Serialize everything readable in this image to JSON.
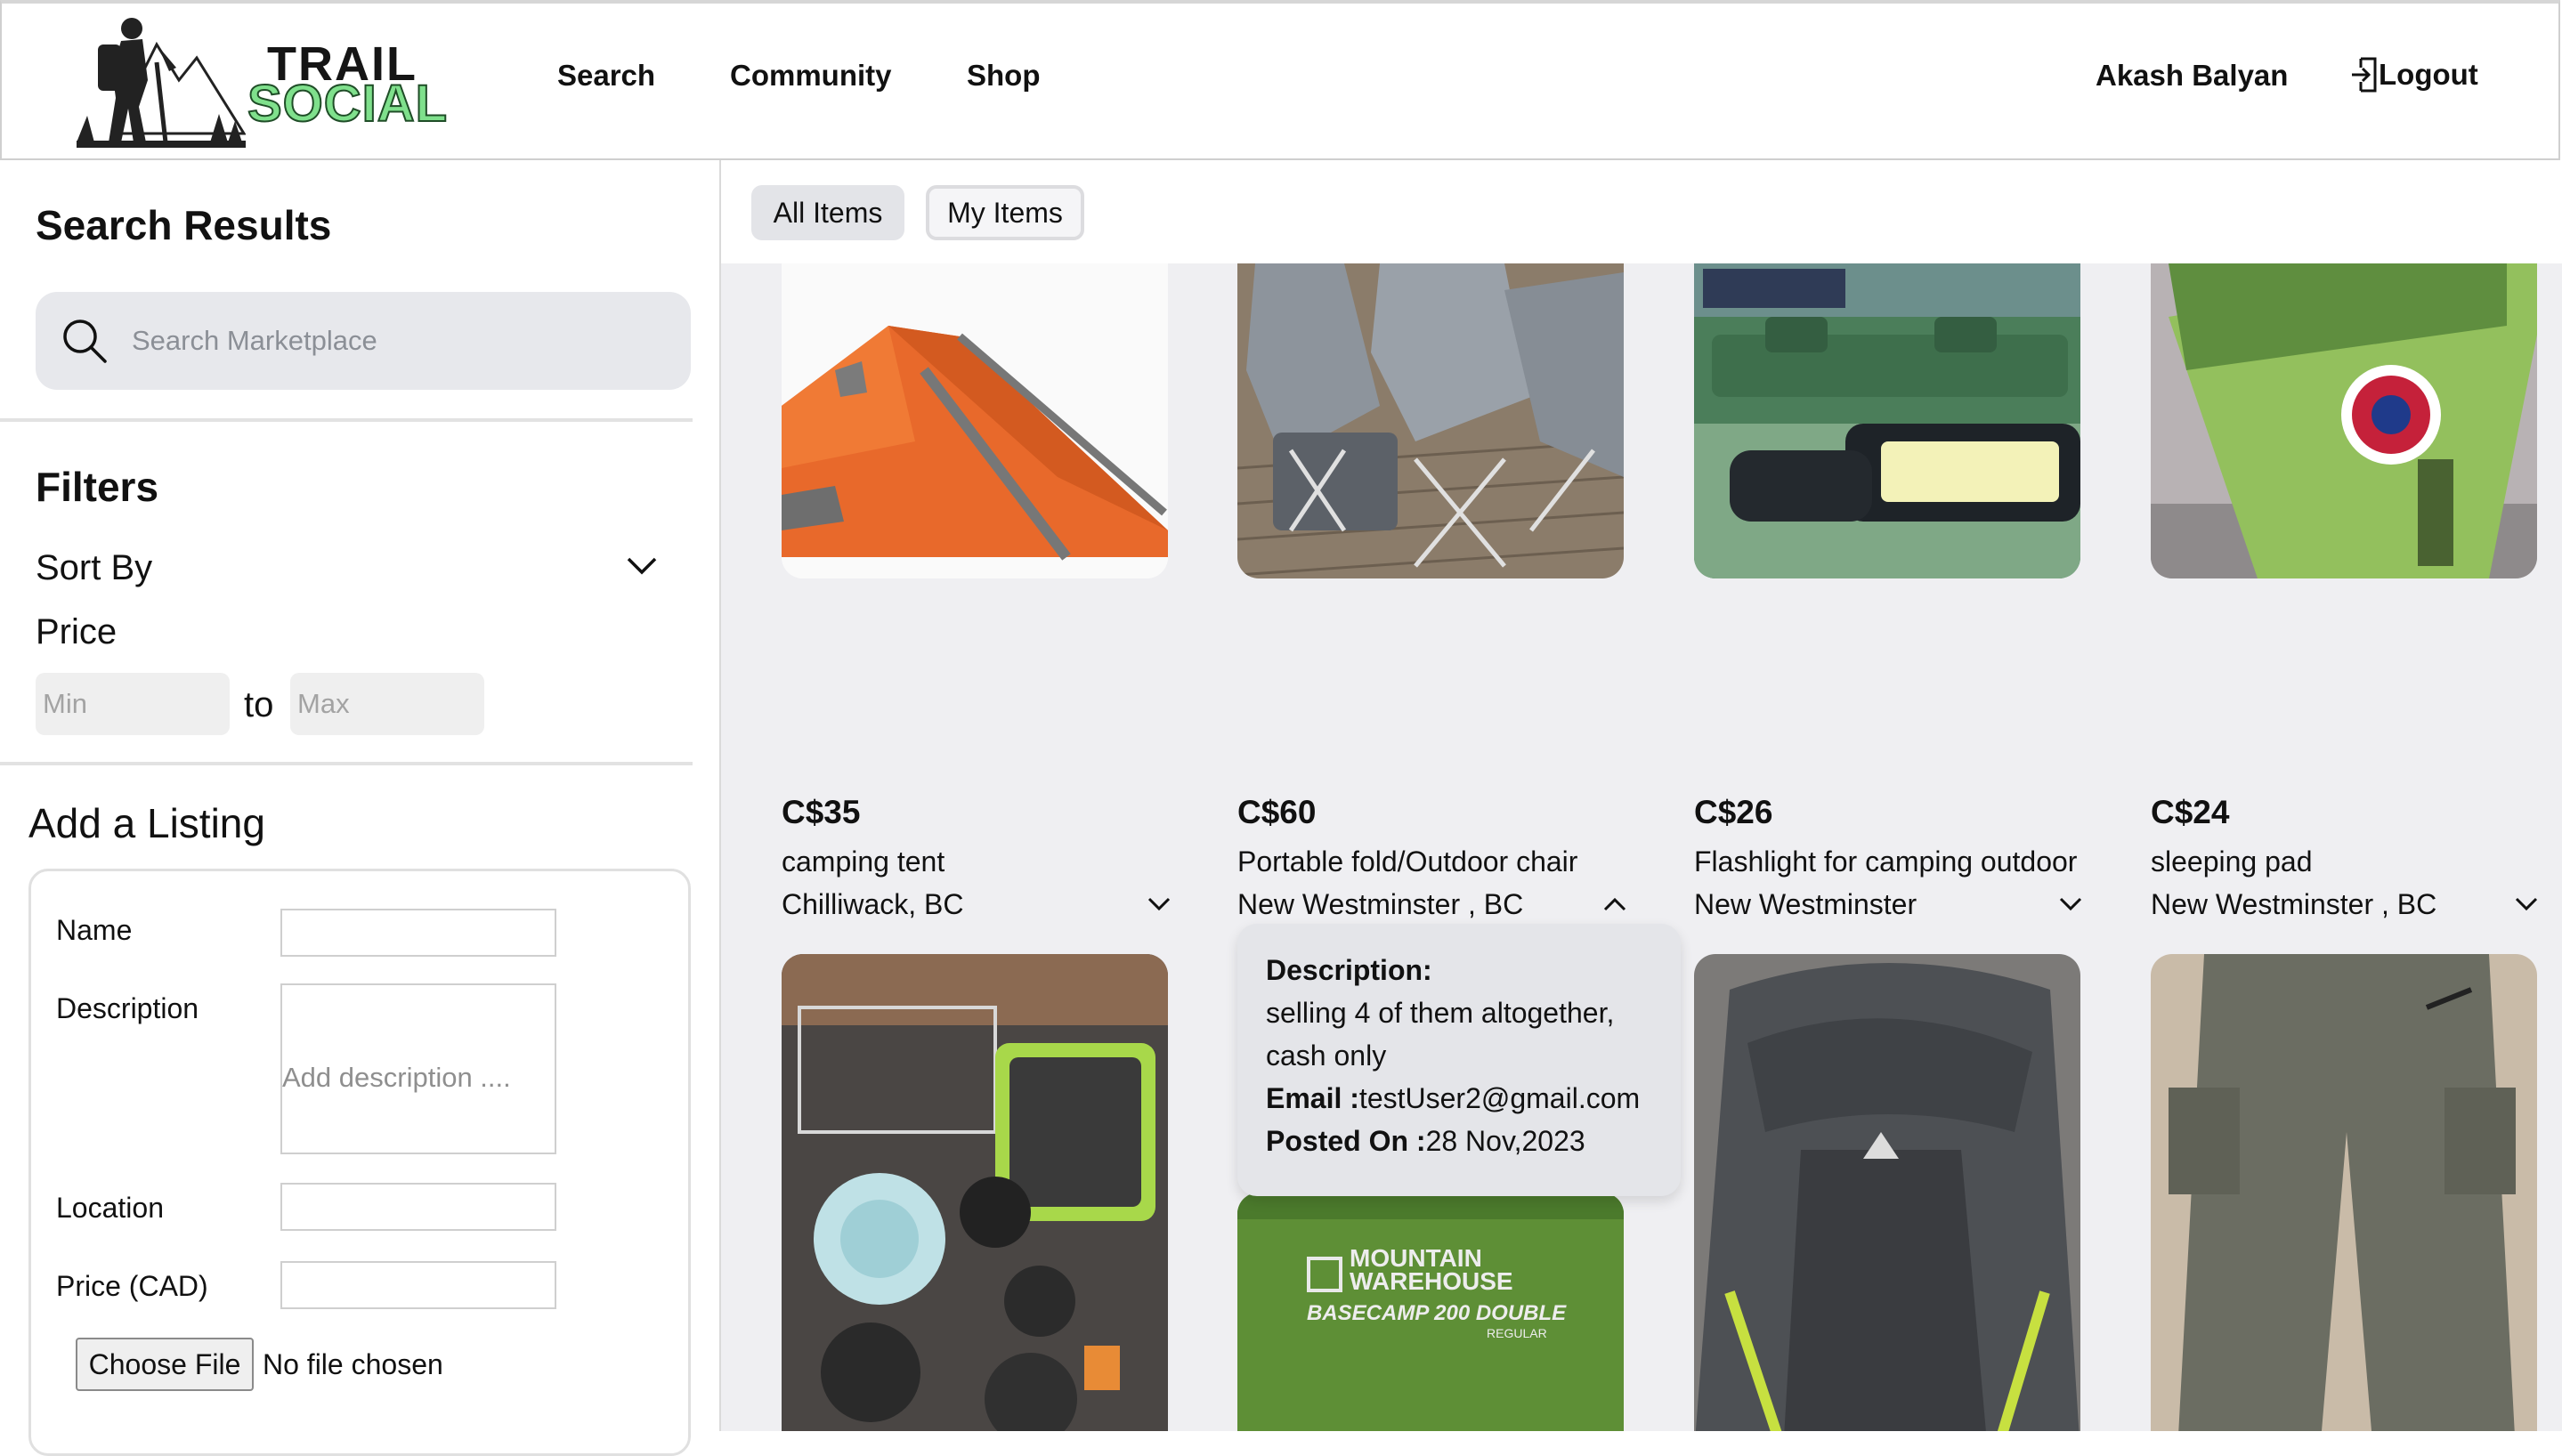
{
  "app": {
    "logo_top": "TRAIL",
    "logo_bottom": "SOCIAL"
  },
  "nav": {
    "items": [
      "Search",
      "Community",
      "Shop"
    ],
    "user_name": "Akash Balyan",
    "logout_label": "Logout"
  },
  "sidebar": {
    "search_title": "Search Results",
    "search_placeholder": "Search Marketplace",
    "filters_title": "Filters",
    "sort_by_label": "Sort By",
    "price_label": "Price",
    "price_min_placeholder": "Min",
    "price_to": "to",
    "price_max_placeholder": "Max",
    "add_listing_title": "Add a Listing",
    "form": {
      "name_label": "Name",
      "description_label": "Description",
      "description_placeholder": "Add description ....",
      "location_label": "Location",
      "price_label": "Price (CAD)",
      "choose_file_label": "Choose File",
      "file_status": "No file chosen"
    }
  },
  "tabs": [
    "All Items",
    "My Items"
  ],
  "listings": [
    {
      "price": "C$35",
      "title": "camping tent",
      "location": "Chilliwack, BC",
      "image": "orange-tent",
      "expanded": false
    },
    {
      "price": "C$60",
      "title": "Portable fold/Outdoor chair",
      "location": "New Westminster , BC",
      "image": "folding-chairs",
      "expanded": true
    },
    {
      "price": "C$26",
      "title": "Flashlight for camping outdoor",
      "location": "New Westminster",
      "image": "flashlight-case",
      "expanded": false
    },
    {
      "price": "C$24",
      "title": "sleeping pad",
      "location": "New Westminster , BC",
      "image": "green-sleeping-pad",
      "expanded": false
    }
  ],
  "second_row_images": [
    "cookware-set",
    "sleeping-bag",
    "backpack",
    "hiking-pants"
  ],
  "second_row_text": {
    "brand_line1": "MOUNTAIN",
    "brand_line2": "WAREHOUSE",
    "brand_line3": "BASECAMP 200 DOUBLE",
    "brand_line4": "REGULAR"
  },
  "details_popup": {
    "description_label": "Description:",
    "description_line1": "selling 4 of them altogether,",
    "description_line2": "cash only",
    "email_label": "Email :",
    "email_value": "testUser2@gmail.com",
    "posted_label": "Posted On :",
    "posted_value": "28 Nov,2023"
  },
  "colors": {
    "logo_green": "#7fe08c",
    "main_bg": "#efeff2",
    "search_bg": "#e7e8ec"
  }
}
